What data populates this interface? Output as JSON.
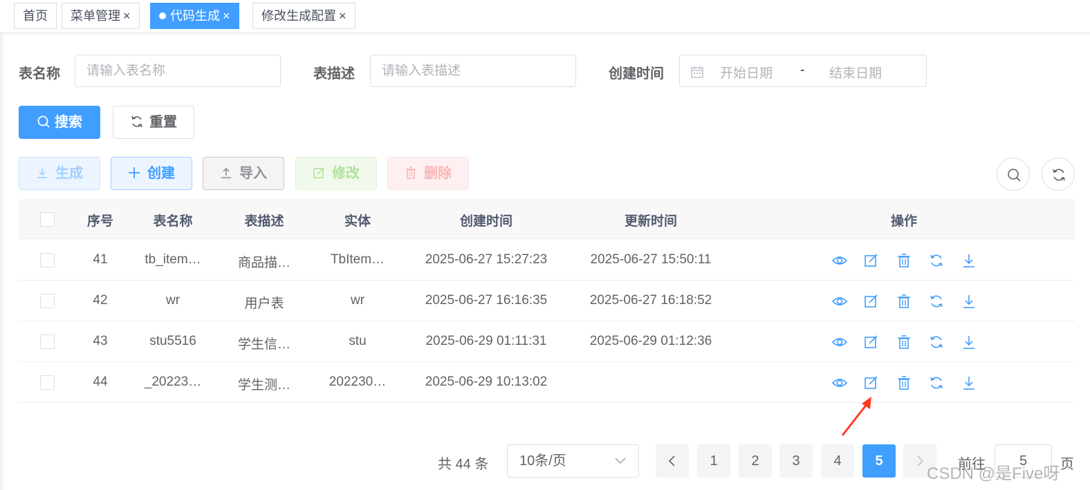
{
  "tabs": [
    {
      "label": "首页",
      "closable": false,
      "active": false
    },
    {
      "label": "菜单管理",
      "closable": true,
      "active": false
    },
    {
      "label": "代码生成",
      "closable": true,
      "active": true
    },
    {
      "label": "修改生成配置",
      "closable": true,
      "active": false
    }
  ],
  "tab_close_glyph": "×",
  "search": {
    "table_name_label": "表名称",
    "table_name_placeholder": "请输入表名称",
    "table_desc_label": "表描述",
    "table_desc_placeholder": "请输入表描述",
    "created_label": "创建时间",
    "start_placeholder": "开始日期",
    "range_separator": "-",
    "end_placeholder": "结束日期",
    "search_button": "搜索",
    "reset_button": "重置"
  },
  "toolbar": {
    "generate": "生成",
    "create": "创建",
    "import": "导入",
    "edit": "修改",
    "delete": "删除"
  },
  "table": {
    "columns": [
      "序号",
      "表名称",
      "表描述",
      "实体",
      "创建时间",
      "更新时间",
      "操作"
    ],
    "rows": [
      {
        "index": "41",
        "name": "tb_item…",
        "desc": "商品描…",
        "entity": "TbItem…",
        "created": "2025-06-27 15:27:23",
        "updated": "2025-06-27 15:50:11"
      },
      {
        "index": "42",
        "name": "wr",
        "desc": "用户表",
        "entity": "wr",
        "created": "2025-06-27 16:16:35",
        "updated": "2025-06-27 16:18:52"
      },
      {
        "index": "43",
        "name": "stu5516",
        "desc": "学生信…",
        "entity": "stu",
        "created": "2025-06-29 01:11:31",
        "updated": "2025-06-29 01:12:36"
      },
      {
        "index": "44",
        "name": "_20223…",
        "desc": "学生测…",
        "entity": "202230…",
        "created": "2025-06-29 10:13:02",
        "updated": ""
      }
    ],
    "row_actions": [
      "eye-icon",
      "edit-icon",
      "delete-icon",
      "sync-icon",
      "download-icon"
    ]
  },
  "pagination": {
    "total": "共 44 条",
    "page_size": "10条/页",
    "pages": [
      "1",
      "2",
      "3",
      "4",
      "5"
    ],
    "current": "5",
    "goto_label": "前往",
    "goto_value": "5",
    "page_suffix": "页"
  },
  "watermark": "CSDN @是Five呀",
  "colors": {
    "primary": "#409eff",
    "arrow": "#ff3b1f"
  }
}
